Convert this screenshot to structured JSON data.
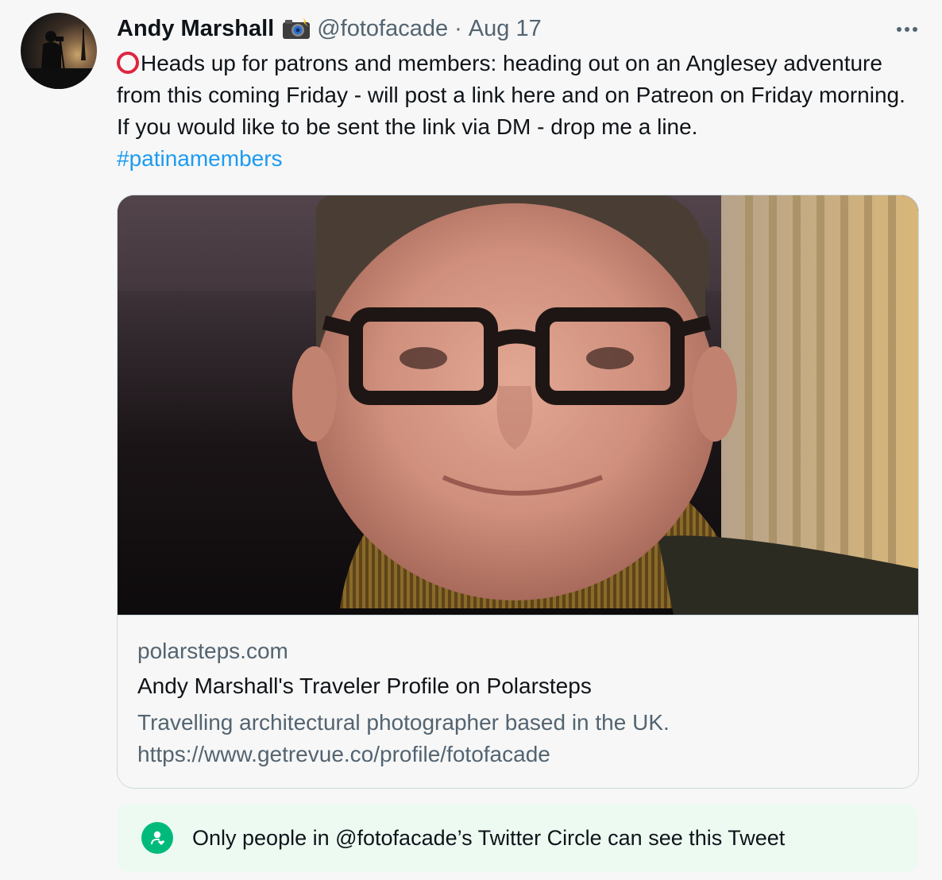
{
  "tweet": {
    "author_name": "Andy Marshall",
    "author_emoji": "camera-with-flash-icon",
    "handle": "@fotofacade",
    "separator": "·",
    "date": "Aug 17",
    "text": "Heads up for patrons and members: heading out on an Anglesey adventure from this coming Friday - will post a link here and on Patreon on Friday morning. If you would like to be sent the link via DM - drop me a line.",
    "hashtag": "#patinamembers",
    "leading_emoji": "hollow-red-circle-icon"
  },
  "card": {
    "domain": "polarsteps.com",
    "title": "Andy Marshall's Traveler Profile on Polarsteps",
    "description_line1": "Travelling architectural photographer based in the UK.",
    "description_line2": "https://www.getrevue.co/profile/fotofacade"
  },
  "circle_notice": {
    "text": "Only people in @fotofacade’s Twitter Circle can see this Tweet",
    "icon": "twitter-circle-icon"
  },
  "colors": {
    "link": "#1d9bf0",
    "secondary_text": "#536471",
    "circle_green": "#00ba7c",
    "circle_banner_bg": "#edfaf2",
    "emoji_red": "#e0253f"
  }
}
